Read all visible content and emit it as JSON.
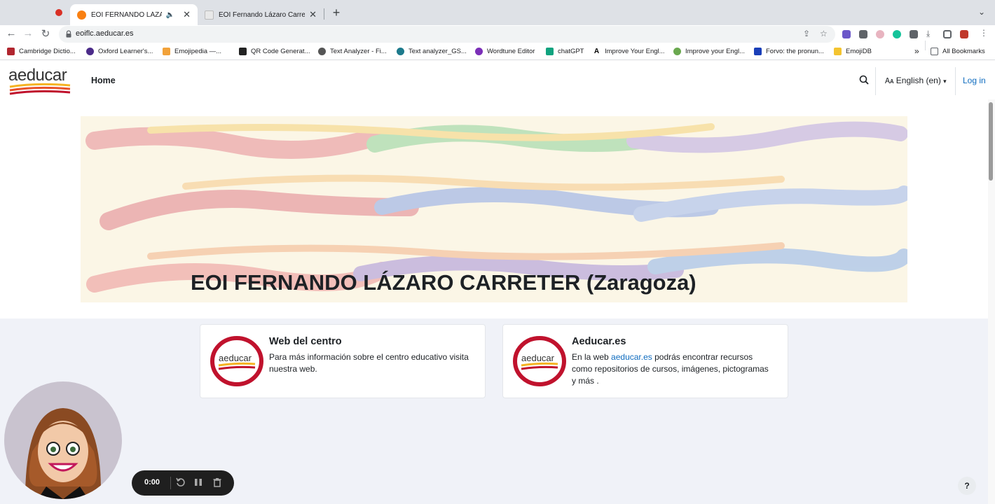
{
  "browser": {
    "tabs": [
      {
        "title": "EOI FERNANDO LÁZARO C",
        "active": true,
        "audio": true
      },
      {
        "title": "EOI Fernando Lázaro Carreter",
        "active": false
      }
    ],
    "url": "eoiflc.aeducar.es",
    "bookmarks": [
      "Cambridge Dictio...",
      "Oxford Learner's...",
      "Emojipedia —...",
      "QR Code Generat...",
      "Text Analyzer - Fi...",
      "Text analyzer_GS...",
      "Wordtune Editor",
      "chatGPT",
      "Improve Your Engl...",
      "Improve your Engl...",
      "Forvo: the pronun...",
      "EmojiDB"
    ],
    "bookmarks_overflow": "»",
    "all_bookmarks": "All Bookmarks"
  },
  "site": {
    "logo": "aeducar",
    "nav_home": "Home",
    "language": "English (en)",
    "login": "Log in"
  },
  "main": {
    "title": "EOI FERNANDO LÁZARO CARRETER (Zaragoza)",
    "cards": [
      {
        "logo_text": "aeducar",
        "title": "Web del centro",
        "text": "Para más información sobre el centro educativo visita nuestra web."
      },
      {
        "logo_text": "aeducar",
        "title": "Aeducar.es",
        "text_before": "En la web ",
        "link": "aeducar.es",
        "text_after": " podrás encontrar recursos como repositorios de cursos, imágenes, pictogramas y más ."
      }
    ]
  },
  "recorder": {
    "time": "0:00"
  },
  "help": "?",
  "colors": {
    "link": "#0f6cbf",
    "recording": "#d93025",
    "page_bg": "#f0f2f8"
  }
}
